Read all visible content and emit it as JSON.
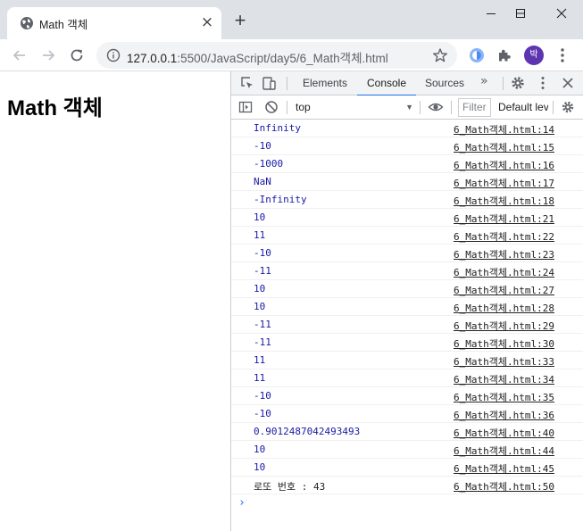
{
  "browser": {
    "tab_title": "Math 객체",
    "tab_close": "×",
    "new_tab": "+",
    "url_host": "127.0.0.1",
    "url_rest": ":5500/JavaScript/day5/6_Math객체.html",
    "avatar_initial": "박"
  },
  "page": {
    "heading": "Math 객체"
  },
  "devtools": {
    "tabs": [
      {
        "label": "Elements"
      },
      {
        "label": "Console",
        "active": true
      },
      {
        "label": "Sources"
      }
    ],
    "more_tabs": "»",
    "context": "top",
    "filter_placeholder": "Filter",
    "levels_label": "Default levels",
    "console_rows": [
      {
        "value": "Infinity",
        "source": "6_Math객체.html:14"
      },
      {
        "value": "-10",
        "source": "6_Math객체.html:15"
      },
      {
        "value": "-1000",
        "source": "6_Math객체.html:16"
      },
      {
        "value": "NaN",
        "source": "6_Math객체.html:17"
      },
      {
        "value": "-Infinity",
        "source": "6_Math객체.html:18"
      },
      {
        "value": "10",
        "source": "6_Math객체.html:21"
      },
      {
        "value": "11",
        "source": "6_Math객체.html:22"
      },
      {
        "value": "-10",
        "source": "6_Math객체.html:23"
      },
      {
        "value": "-11",
        "source": "6_Math객체.html:24"
      },
      {
        "value": "10",
        "source": "6_Math객체.html:27"
      },
      {
        "value": "10",
        "source": "6_Math객체.html:28"
      },
      {
        "value": "-11",
        "source": "6_Math객체.html:29"
      },
      {
        "value": "-11",
        "source": "6_Math객체.html:30"
      },
      {
        "value": "11",
        "source": "6_Math객체.html:33"
      },
      {
        "value": "11",
        "source": "6_Math객체.html:34"
      },
      {
        "value": "-10",
        "source": "6_Math객체.html:35"
      },
      {
        "value": "-10",
        "source": "6_Math객체.html:36"
      },
      {
        "value": "0.9012487042493493",
        "source": "6_Math객체.html:40"
      },
      {
        "value": "10",
        "source": "6_Math객체.html:44"
      },
      {
        "value": "10",
        "source": "6_Math객체.html:45"
      },
      {
        "value": "로또 번호 : 43",
        "source": "6_Math객체.html:50",
        "is_string": true
      }
    ],
    "prompt": "›"
  },
  "colors": {
    "number_blue": "#1a1aa6",
    "accent": "#1a73e8",
    "avatar": "#5e35b1"
  }
}
